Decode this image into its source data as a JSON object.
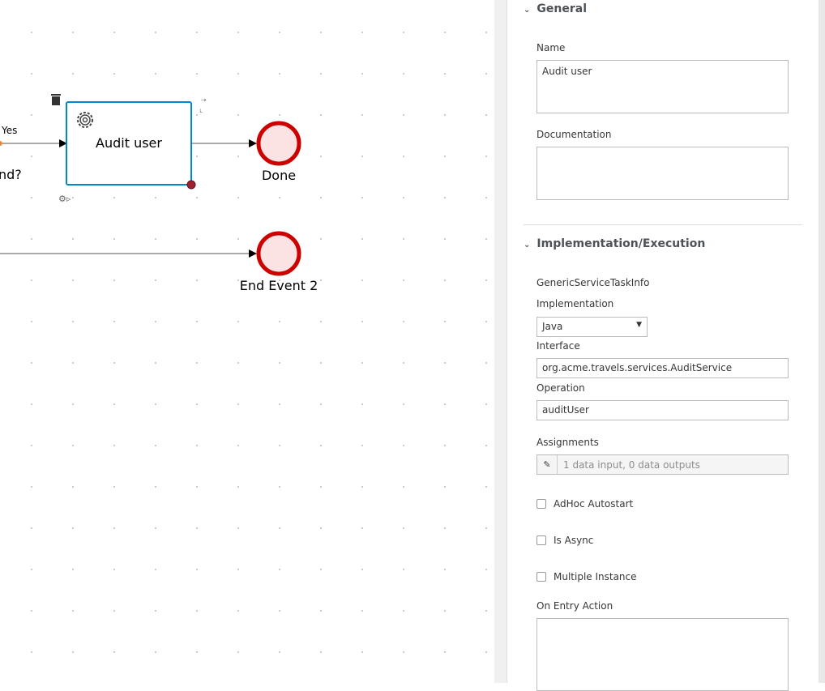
{
  "canvas": {
    "task": {
      "label": "Audit user",
      "icon": "gear-icon"
    },
    "flow_label": "Yes",
    "gateway_label_fragment": "nd?",
    "end_events": [
      {
        "label": "Done"
      },
      {
        "label": "End Event 2"
      }
    ],
    "colors": {
      "task_border": "#0088ce",
      "end_event_stroke": "#c00",
      "end_event_fill": "#fce3e3"
    }
  },
  "panel": {
    "general": {
      "title": "General",
      "name_label": "Name",
      "name_value": "Audit user",
      "doc_label": "Documentation",
      "doc_value": ""
    },
    "impl": {
      "title": "Implementation/Execution",
      "info": "GenericServiceTaskInfo",
      "impl_label": "Implementation",
      "impl_value": "Java",
      "interface_label": "Interface",
      "interface_value": "org.acme.travels.services.AuditService",
      "operation_label": "Operation",
      "operation_value": "auditUser",
      "assignments_label": "Assignments",
      "assignments_value": "1 data input, 0 data outputs",
      "adhoc_label": "AdHoc Autostart",
      "adhoc_checked": false,
      "async_label": "Is Async",
      "async_checked": false,
      "multi_label": "Multiple Instance",
      "multi_checked": false,
      "entry_label": "On Entry Action",
      "entry_value": ""
    }
  }
}
